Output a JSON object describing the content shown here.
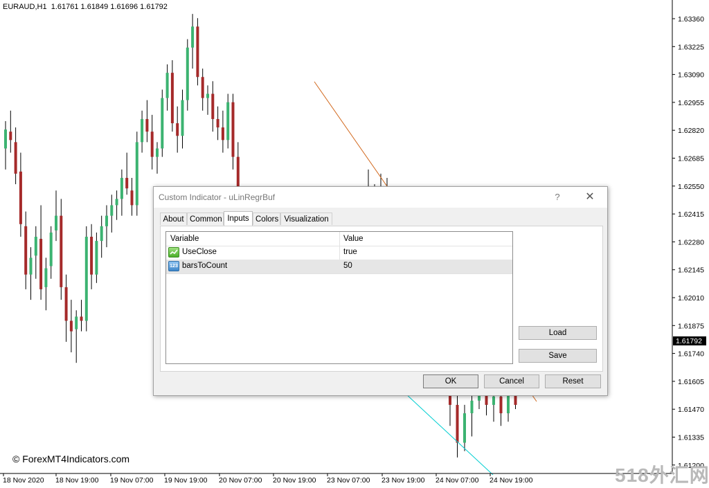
{
  "chart": {
    "symbol": "EURAUD,H1",
    "ohlc": "1.61761 1.61849 1.61696 1.61792",
    "current_price": "1.61792",
    "price_levels": [
      "1.63360",
      "1.63225",
      "1.63090",
      "1.62955",
      "1.62820",
      "1.62685",
      "1.62550",
      "1.62415",
      "1.62280",
      "1.62145",
      "1.62010",
      "1.61875",
      "1.61740",
      "1.61605",
      "1.61470",
      "1.61335",
      "1.61200"
    ],
    "time_labels": [
      "18 Nov 2020",
      "18 Nov 19:00",
      "19 Nov 07:00",
      "19 Nov 19:00",
      "20 Nov 07:00",
      "20 Nov 19:00",
      "23 Nov 07:00",
      "23 Nov 19:00",
      "24 Nov 07:00",
      "24 Nov 19:00"
    ],
    "bull_color": "#3cb371",
    "bear_color": "#a52a2a",
    "candles": [
      [
        1.6272,
        1.6285,
        1.6262,
        1.6281
      ],
      [
        1.628,
        1.629,
        1.627,
        1.6276
      ],
      [
        1.6275,
        1.6282,
        1.6255,
        1.626
      ],
      [
        1.6261,
        1.627,
        1.623,
        1.6236
      ],
      [
        1.6235,
        1.6242,
        1.6205,
        1.6212
      ],
      [
        1.6212,
        1.6225,
        1.62,
        1.622
      ],
      [
        1.6221,
        1.6235,
        1.621,
        1.623
      ],
      [
        1.6229,
        1.6245,
        1.62,
        1.6205
      ],
      [
        1.6206,
        1.622,
        1.6195,
        1.6215
      ],
      [
        1.6216,
        1.6235,
        1.621,
        1.6232
      ],
      [
        1.6233,
        1.6252,
        1.6228,
        1.624
      ],
      [
        1.624,
        1.6248,
        1.62,
        1.6206
      ],
      [
        1.6206,
        1.6212,
        1.618,
        1.619
      ],
      [
        1.619,
        1.62,
        1.6175,
        1.6185
      ],
      [
        1.6186,
        1.6195,
        1.617,
        1.6192
      ],
      [
        1.6192,
        1.62,
        1.6185,
        1.619
      ],
      [
        1.619,
        1.6235,
        1.6185,
        1.623
      ],
      [
        1.623,
        1.6236,
        1.6205,
        1.6212
      ],
      [
        1.6212,
        1.6232,
        1.6208,
        1.6228
      ],
      [
        1.6228,
        1.624,
        1.622,
        1.6235
      ],
      [
        1.6235,
        1.6245,
        1.6225,
        1.624
      ],
      [
        1.624,
        1.625,
        1.6232,
        1.6245
      ],
      [
        1.6245,
        1.6252,
        1.6238,
        1.6248
      ],
      [
        1.6248,
        1.6262,
        1.624,
        1.6258
      ],
      [
        1.6258,
        1.627,
        1.625,
        1.6253
      ],
      [
        1.6252,
        1.6258,
        1.624,
        1.6245
      ],
      [
        1.6245,
        1.628,
        1.624,
        1.6275
      ],
      [
        1.6275,
        1.629,
        1.627,
        1.6286
      ],
      [
        1.6286,
        1.6295,
        1.6275,
        1.628
      ],
      [
        1.628,
        1.6288,
        1.6262,
        1.6268
      ],
      [
        1.6268,
        1.6275,
        1.626,
        1.6272
      ],
      [
        1.6272,
        1.63,
        1.6268,
        1.6296
      ],
      [
        1.6296,
        1.6312,
        1.629,
        1.6308
      ],
      [
        1.6308,
        1.6314,
        1.628,
        1.6284
      ],
      [
        1.6284,
        1.6292,
        1.627,
        1.6278
      ],
      [
        1.6278,
        1.63,
        1.6272,
        1.6295
      ],
      [
        1.6295,
        1.6324,
        1.629,
        1.632
      ],
      [
        1.632,
        1.6336,
        1.631,
        1.633
      ],
      [
        1.633,
        1.6334,
        1.6302,
        1.6306
      ],
      [
        1.6306,
        1.631,
        1.629,
        1.6296
      ],
      [
        1.6296,
        1.6302,
        1.6288,
        1.6298
      ],
      [
        1.6298,
        1.6304,
        1.628,
        1.6286
      ],
      [
        1.6286,
        1.6292,
        1.6276,
        1.6282
      ],
      [
        1.6282,
        1.629,
        1.627,
        1.6276
      ],
      [
        1.6276,
        1.6298,
        1.6272,
        1.6294
      ],
      [
        1.6294,
        1.6298,
        1.6262,
        1.6268
      ],
      [
        1.6268,
        1.6275,
        1.6242,
        1.6248
      ]
    ],
    "candles_right": [
      [
        1.616,
        1.6172,
        1.614,
        1.615
      ],
      [
        1.615,
        1.616,
        1.6125,
        1.6132
      ],
      [
        1.6132,
        1.615,
        1.6128,
        1.6146
      ],
      [
        1.6146,
        1.6158,
        1.6135,
        1.6152
      ],
      [
        1.6152,
        1.616,
        1.6148,
        1.6155
      ],
      [
        1.6155,
        1.616,
        1.6145,
        1.615
      ],
      [
        1.615,
        1.6158,
        1.6142,
        1.6154
      ],
      [
        1.6154,
        1.6158,
        1.614,
        1.6146
      ],
      [
        1.6146,
        1.616,
        1.6142,
        1.6155
      ],
      [
        1.6155,
        1.6162,
        1.6148,
        1.615
      ]
    ],
    "candles_top": [
      [
        1.625,
        1.6262,
        1.624,
        1.6248
      ],
      [
        1.6248,
        1.6255,
        1.6235,
        1.6252
      ],
      [
        1.6252,
        1.626,
        1.624,
        1.6245
      ],
      [
        1.6245,
        1.6258,
        1.6238,
        1.625
      ]
    ],
    "ylim": [
      1.612,
      1.634
    ]
  },
  "watermark": {
    "left": "© ForexMT4Indicators.com",
    "right": "518外汇网"
  },
  "dialog": {
    "title": "Custom Indicator - uLinRegrBuf",
    "help_label": "?",
    "close_label": "✕",
    "tabs": [
      "About",
      "Common",
      "Inputs",
      "Colors",
      "Visualization"
    ],
    "active_tab": "Inputs",
    "grid": {
      "col_variable": "Variable",
      "col_value": "Value",
      "rows": [
        {
          "icon": "boolean-icon",
          "variable": "UseClose",
          "value": "true"
        },
        {
          "icon": "integer-icon",
          "icon_text": "123",
          "variable": "barsToCount",
          "value": "50"
        }
      ]
    },
    "buttons": {
      "load": "Load",
      "save": "Save",
      "ok": "OK",
      "cancel": "Cancel",
      "reset": "Reset"
    }
  }
}
